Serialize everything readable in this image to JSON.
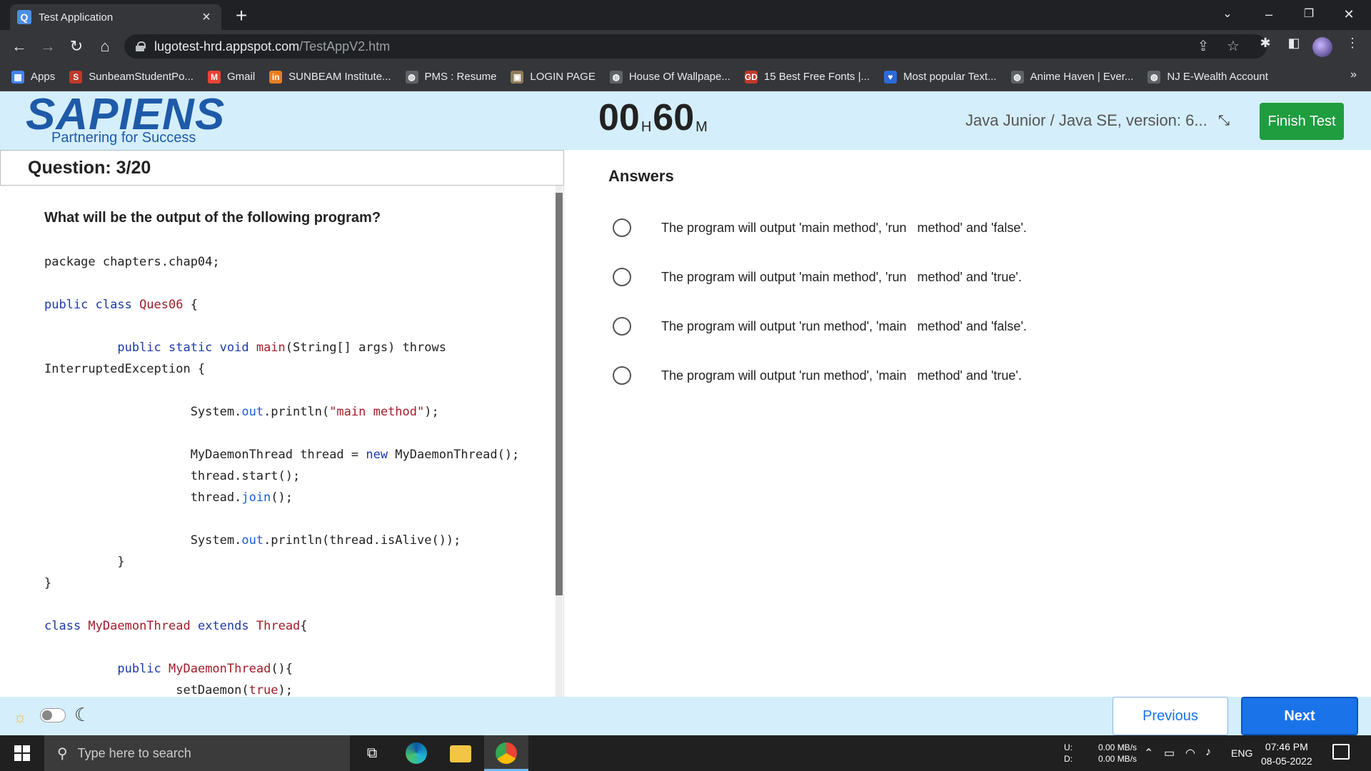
{
  "browser": {
    "tab_title": "Test Application",
    "tab_favicon": "Q",
    "url_host": "lugotest-hrd.appspot.com",
    "url_path": "/TestAppV2.htm",
    "bookmarks": [
      {
        "label": "Apps",
        "icon": "apps-grid-icon",
        "color": "#4285f4",
        "glyph": "▦"
      },
      {
        "label": "SunbeamStudentPo...",
        "icon": "sunbeam-icon",
        "color": "#c0392b",
        "glyph": "S"
      },
      {
        "label": "Gmail",
        "icon": "gmail-icon",
        "color": "#ea4335",
        "glyph": "M"
      },
      {
        "label": "SUNBEAM Institute...",
        "icon": "sunbeam-institute-icon",
        "color": "#e67e22",
        "glyph": "in"
      },
      {
        "label": "PMS : Resume",
        "icon": "globe-icon",
        "color": "#5f6368",
        "glyph": "◍"
      },
      {
        "label": "LOGIN PAGE",
        "icon": "login-page-icon",
        "color": "#8e7d5a",
        "glyph": "▣"
      },
      {
        "label": "House Of Wallpape...",
        "icon": "globe-icon",
        "color": "#5f6368",
        "glyph": "◍"
      },
      {
        "label": "15 Best Free Fonts |...",
        "icon": "fonts-icon",
        "color": "#c0392b",
        "glyph": "GD"
      },
      {
        "label": "Most popular Text...",
        "icon": "heart-icon",
        "color": "#2b6bd6",
        "glyph": "♥"
      },
      {
        "label": "Anime Haven | Ever...",
        "icon": "globe-icon",
        "color": "#5f6368",
        "glyph": "◍"
      },
      {
        "label": "NJ E-Wealth Account",
        "icon": "globe-icon",
        "color": "#5f6368",
        "glyph": "◍"
      }
    ],
    "bookmarks_more": "»"
  },
  "header": {
    "logo_text": "SAPIENS",
    "logo_tagline": "Partnering for Success",
    "timer_hours": "00",
    "timer_hours_unit": "H",
    "timer_minutes": "60",
    "timer_minutes_unit": "M",
    "test_name": "Java Junior / Java SE, version: 6...",
    "finish_label": "Finish Test"
  },
  "question": {
    "counter": "Question: 3/20",
    "prompt": "What will be the output of the following program?",
    "code_lines": [
      [
        {
          "t": "package chapters.chap04;",
          "c": ""
        }
      ],
      [
        {
          "t": "",
          "c": ""
        }
      ],
      [
        {
          "t": "public class ",
          "c": "kw"
        },
        {
          "t": "Ques06",
          "c": "ty"
        },
        {
          "t": " {",
          "c": ""
        }
      ],
      [
        {
          "t": "",
          "c": ""
        }
      ],
      [
        {
          "t": "          ",
          "c": ""
        },
        {
          "t": "public static void ",
          "c": "kw"
        },
        {
          "t": "main",
          "c": "ty"
        },
        {
          "t": "(String[] args) throws",
          "c": ""
        }
      ],
      [
        {
          "t": "InterruptedException {",
          "c": ""
        }
      ],
      [
        {
          "t": "",
          "c": ""
        }
      ],
      [
        {
          "t": "                    System.",
          "c": ""
        },
        {
          "t": "out",
          "c": "fld"
        },
        {
          "t": ".println(",
          "c": ""
        },
        {
          "t": "\"main method\"",
          "c": "st"
        },
        {
          "t": ");",
          "c": ""
        }
      ],
      [
        {
          "t": "",
          "c": ""
        }
      ],
      [
        {
          "t": "                    MyDaemonThread thread = ",
          "c": ""
        },
        {
          "t": "new",
          "c": "kw"
        },
        {
          "t": " MyDaemonThread();",
          "c": ""
        }
      ],
      [
        {
          "t": "                    thread.start();",
          "c": ""
        }
      ],
      [
        {
          "t": "                    thread.",
          "c": ""
        },
        {
          "t": "join",
          "c": "fld"
        },
        {
          "t": "();",
          "c": ""
        }
      ],
      [
        {
          "t": "",
          "c": ""
        }
      ],
      [
        {
          "t": "                    System.",
          "c": ""
        },
        {
          "t": "out",
          "c": "fld"
        },
        {
          "t": ".println(thread.isAlive());",
          "c": ""
        }
      ],
      [
        {
          "t": "          }",
          "c": ""
        }
      ],
      [
        {
          "t": "}",
          "c": ""
        }
      ],
      [
        {
          "t": "",
          "c": ""
        }
      ],
      [
        {
          "t": "class ",
          "c": "kw"
        },
        {
          "t": "MyDaemonThread",
          "c": "ty"
        },
        {
          "t": " ",
          "c": ""
        },
        {
          "t": "extends",
          "c": "kw"
        },
        {
          "t": " ",
          "c": ""
        },
        {
          "t": "Thread",
          "c": "ty"
        },
        {
          "t": "{",
          "c": ""
        }
      ],
      [
        {
          "t": "",
          "c": ""
        }
      ],
      [
        {
          "t": "          ",
          "c": ""
        },
        {
          "t": "public ",
          "c": "kw"
        },
        {
          "t": "MyDaemonThread",
          "c": "ty"
        },
        {
          "t": "(){",
          "c": ""
        }
      ],
      [
        {
          "t": "                  setDaemon(",
          "c": ""
        },
        {
          "t": "true",
          "c": "st"
        },
        {
          "t": ");",
          "c": ""
        }
      ]
    ]
  },
  "answers": {
    "title": "Answers",
    "options": [
      "The program will output 'main method', 'run   method' and 'false'.",
      "The program will output 'main method', 'run   method' and 'true'.",
      "The program will output 'run method', 'main   method' and 'false'.",
      "The program will output 'run method', 'main   method' and 'true'."
    ]
  },
  "footer": {
    "previous_label": "Previous",
    "next_label": "Next"
  },
  "taskbar": {
    "search_placeholder": "Type here to search",
    "net_up_label": "U:",
    "net_down_label": "D:",
    "net_up": "0.00 MB/s",
    "net_down": "0.00 MB/s",
    "lang": "ENG",
    "time": "07:46 PM",
    "date": "08-05-2022"
  },
  "colors": {
    "header_bg": "#d4eefc",
    "brand_blue": "#1e5aa8",
    "finish_green": "#1f9d3f",
    "next_blue": "#1a73e8"
  }
}
